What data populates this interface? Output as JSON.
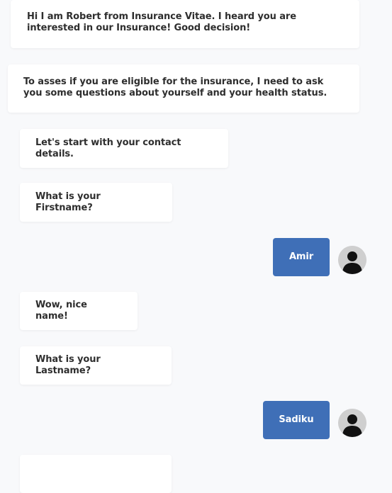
{
  "chat": {
    "messages": [
      {
        "role": "bot",
        "text": "Hi I am Robert from Insurance Vitae. I heard you are interested in our Insurance! Good decision!"
      },
      {
        "role": "bot",
        "text": "To asses if you are eligible for the insurance, I need to ask you some questions about yourself and your health status."
      },
      {
        "role": "bot",
        "text": "Let's start with your contact details."
      },
      {
        "role": "bot",
        "text": "What is your Firstname?"
      },
      {
        "role": "user",
        "text": "Amir",
        "avatar": "user-avatar-icon"
      },
      {
        "role": "bot",
        "text": "Wow, nice name!"
      },
      {
        "role": "bot",
        "text": "What is your Lastname?"
      },
      {
        "role": "user",
        "text": "Sadiku",
        "avatar": "user-avatar-icon"
      }
    ]
  },
  "colors": {
    "background": "#f8f9fb",
    "bot_bubble": "#ffffff",
    "user_bubble": "#3f6fb7",
    "avatar_bg": "#cfcfcf"
  }
}
